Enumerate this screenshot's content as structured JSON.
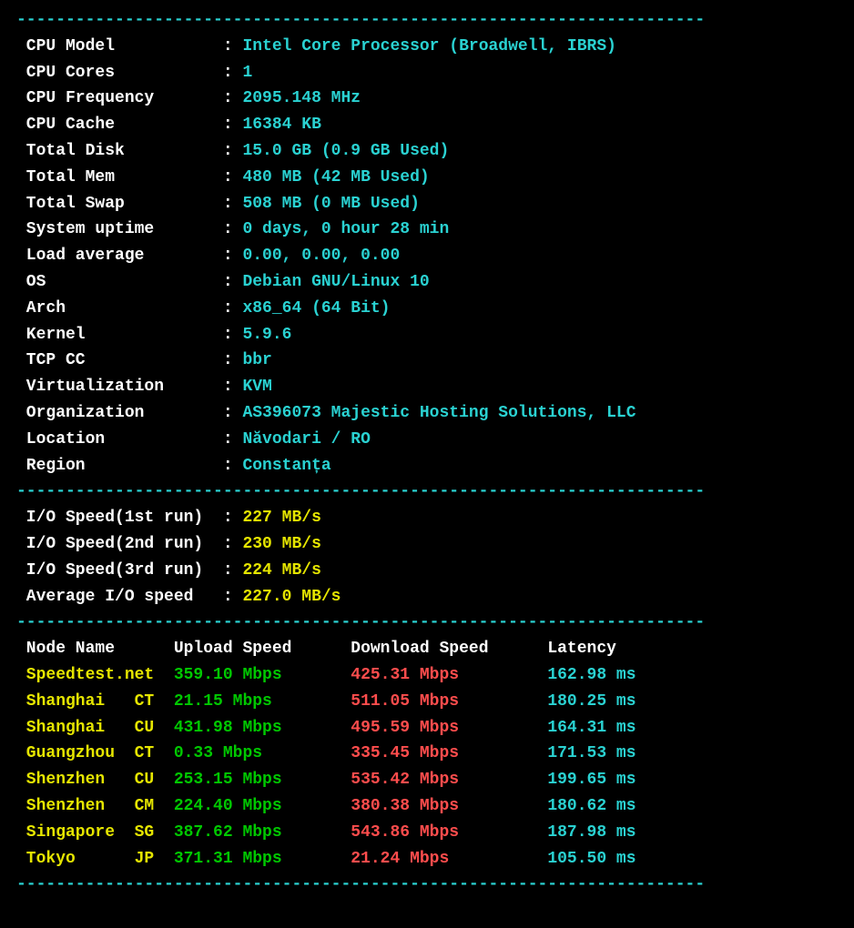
{
  "divider": "----------------------------------------------------------------------",
  "sysinfo": {
    "rows": [
      {
        "label": "CPU Model",
        "value": "Intel Core Processor (Broadwell, IBRS)"
      },
      {
        "label": "CPU Cores",
        "value": "1"
      },
      {
        "label": "CPU Frequency",
        "value": "2095.148 MHz"
      },
      {
        "label": "CPU Cache",
        "value": "16384 KB"
      },
      {
        "label": "Total Disk",
        "value": "15.0 GB (0.9 GB Used)"
      },
      {
        "label": "Total Mem",
        "value": "480 MB (42 MB Used)"
      },
      {
        "label": "Total Swap",
        "value": "508 MB (0 MB Used)"
      },
      {
        "label": "System uptime",
        "value": "0 days, 0 hour 28 min"
      },
      {
        "label": "Load average",
        "value": "0.00, 0.00, 0.00"
      },
      {
        "label": "OS",
        "value": "Debian GNU/Linux 10"
      },
      {
        "label": "Arch",
        "value": "x86_64 (64 Bit)"
      },
      {
        "label": "Kernel",
        "value": "5.9.6"
      },
      {
        "label": "TCP CC",
        "value": "bbr"
      },
      {
        "label": "Virtualization",
        "value": "KVM"
      },
      {
        "label": "Organization",
        "value": "AS396073 Majestic Hosting Solutions, LLC"
      },
      {
        "label": "Location",
        "value": "Năvodari / RO"
      },
      {
        "label": "Region",
        "value": "Constanța"
      }
    ]
  },
  "io": {
    "rows": [
      {
        "label": "I/O Speed(1st run)",
        "value": "227 MB/s"
      },
      {
        "label": "I/O Speed(2nd run)",
        "value": "230 MB/s"
      },
      {
        "label": "I/O Speed(3rd run)",
        "value": "224 MB/s"
      },
      {
        "label": "Average I/O speed",
        "value": "227.0 MB/s"
      }
    ]
  },
  "speedtest": {
    "headers": {
      "node": "Node Name",
      "upload": "Upload Speed",
      "download": "Download Speed",
      "latency": "Latency"
    },
    "rows": [
      {
        "node": "Speedtest.net",
        "upload": "359.10 Mbps",
        "download": "425.31 Mbps",
        "latency": "162.98 ms"
      },
      {
        "node": "Shanghai   CT",
        "upload": "21.15 Mbps",
        "download": "511.05 Mbps",
        "latency": "180.25 ms"
      },
      {
        "node": "Shanghai   CU",
        "upload": "431.98 Mbps",
        "download": "495.59 Mbps",
        "latency": "164.31 ms"
      },
      {
        "node": "Guangzhou  CT",
        "upload": "0.33 Mbps",
        "download": "335.45 Mbps",
        "latency": "171.53 ms"
      },
      {
        "node": "Shenzhen   CU",
        "upload": "253.15 Mbps",
        "download": "535.42 Mbps",
        "latency": "199.65 ms"
      },
      {
        "node": "Shenzhen   CM",
        "upload": "224.40 Mbps",
        "download": "380.38 Mbps",
        "latency": "180.62 ms"
      },
      {
        "node": "Singapore  SG",
        "upload": "387.62 Mbps",
        "download": "543.86 Mbps",
        "latency": "187.98 ms"
      },
      {
        "node": "Tokyo      JP",
        "upload": "371.31 Mbps",
        "download": "21.24 Mbps",
        "latency": "105.50 ms"
      }
    ]
  }
}
